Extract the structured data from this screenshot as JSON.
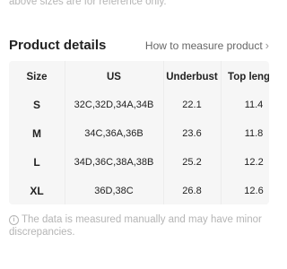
{
  "top_note": "above sizes are for reference only.",
  "details": {
    "title": "Product details",
    "measure_link": "How to measure product",
    "chevron": "›"
  },
  "table": {
    "headers": [
      "Size",
      "US",
      "Underbust",
      "Top length"
    ],
    "rows": [
      [
        "S",
        "32C,32D,34A,34B",
        "22.1",
        "11.4"
      ],
      [
        "M",
        "34C,36A,36B",
        "23.6",
        "11.8"
      ],
      [
        "L",
        "34D,36C,38A,38B",
        "25.2",
        "12.2"
      ],
      [
        "XL",
        "36D,38C",
        "26.8",
        "12.6"
      ]
    ]
  },
  "bottom_note": {
    "icon": "info-icon",
    "icon_glyph": "i",
    "text": "The data is measured manually and may have minor discrepancies."
  },
  "colors": {
    "table_bg": "#f6f6f6",
    "muted_text": "#b5b5b5"
  }
}
